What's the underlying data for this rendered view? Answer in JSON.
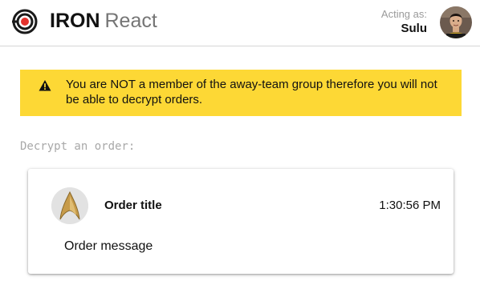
{
  "header": {
    "brand_bold": "IRON",
    "brand_light": "React",
    "logo_icon": "iron-target-logo-icon",
    "acting_label": "Acting as:",
    "acting_user": "Sulu",
    "avatar_icon": "user-avatar-icon"
  },
  "warning": {
    "icon": "warning-triangle-icon",
    "text": "You are NOT a member of the away-team group therefore you will not be able to decrypt orders.",
    "background_color": "#fdd835"
  },
  "section": {
    "title": "Decrypt an order:"
  },
  "order": {
    "avatar_icon": "starfleet-delta-icon",
    "title": "Order title",
    "time": "1:30:56 PM",
    "message": "Order message"
  },
  "colors": {
    "accent_red": "#e5322d",
    "brand_text": "#111111",
    "muted_text": "#9a9a9a"
  }
}
